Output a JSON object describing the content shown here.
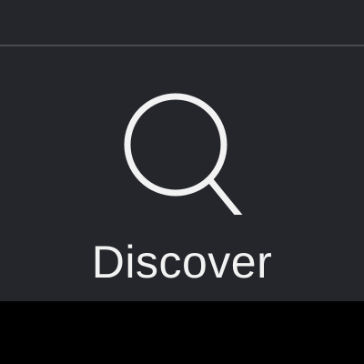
{
  "tab_bar": {
    "background_color": "#25262b",
    "divider_color": "#4a4b50",
    "active_tab": {
      "label": "Discover",
      "icon": "search-icon",
      "icon_color": "#f2f2f2",
      "label_color": "#f2f2f2"
    }
  }
}
